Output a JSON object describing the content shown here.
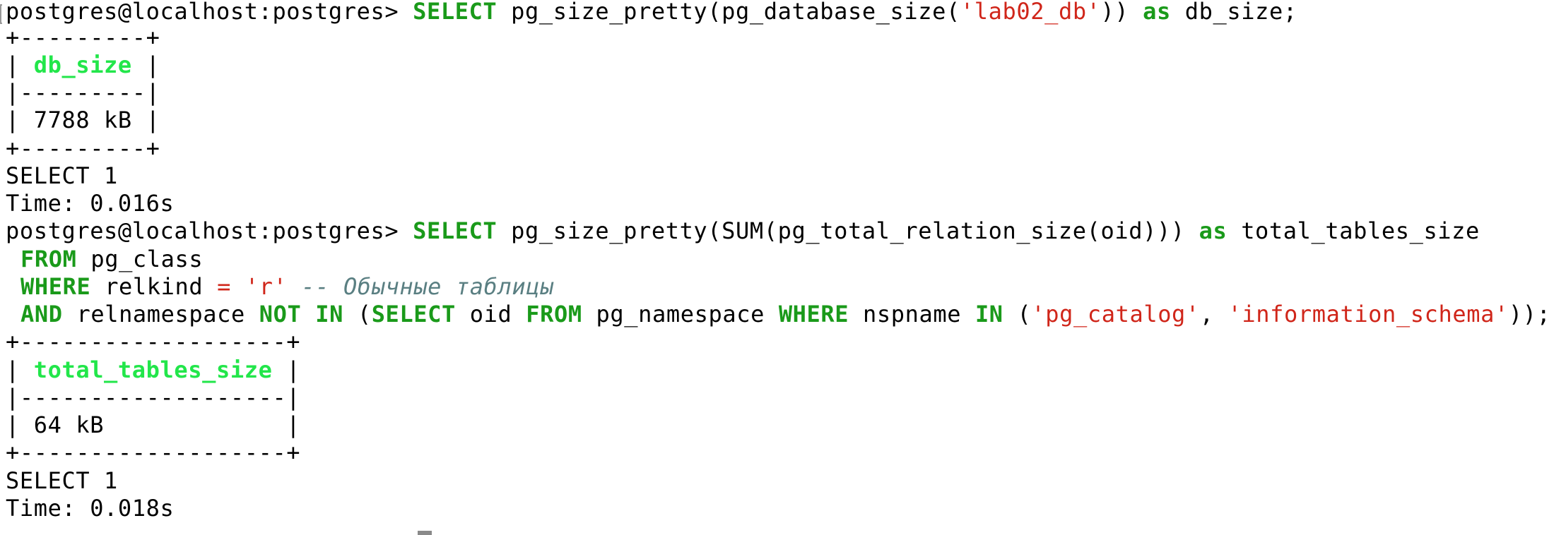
{
  "session1": {
    "prompt": "postgres@localhost:postgres> ",
    "q_select": "SELECT",
    "q_mid": " pg_size_pretty(pg_database_size(",
    "q_string": "'lab02_db'",
    "q_close": ")) ",
    "q_as": "as",
    "q_end": " db_size;",
    "table_border": "+---------+",
    "header_left": "| ",
    "header_text": "db_size",
    "header_right": " |",
    "separator": "|---------|",
    "value_row": "| 7788 kB |",
    "status": "SELECT 1",
    "time": "Time: 0.016s"
  },
  "session2": {
    "prompt": "postgres@localhost:postgres> ",
    "l1_select": "SELECT",
    "l1_mid": " pg_size_pretty(SUM(pg_total_relation_size(oid))) ",
    "l1_as": "as",
    "l1_end": " total_tables_size",
    "l2_from": "FROM",
    "l2_end": " pg_class",
    "l3_where": "WHERE",
    "l3_mid": " relkind ",
    "l3_eq": "=",
    "l3_sp": " ",
    "l3_str": "'r'",
    "l3_comment": " -- Обычные таблицы",
    "l4_and": "AND",
    "l4_a": " relnamespace ",
    "l4_not": "NOT",
    "l4_sp1": " ",
    "l4_in": "IN",
    "l4_paren": " (",
    "l4_select": "SELECT",
    "l4_oid": " oid ",
    "l4_from": "FROM",
    "l4_ns": " pg_namespace ",
    "l4_where": "WHERE",
    "l4_nsp": " nspname ",
    "l4_in2": "IN",
    "l4_open": " (",
    "l4_str1": "'pg_catalog'",
    "l4_comma": ", ",
    "l4_str2": "'information_schema'",
    "l4_close": "));",
    "table_border": "+-------------------+",
    "header_left": "| ",
    "header_text": "total_tables_size",
    "header_right": " |",
    "separator": "|-------------------|",
    "value_row": "| 64 kB             |",
    "status": "SELECT 1",
    "time": "Time: 0.018s"
  }
}
